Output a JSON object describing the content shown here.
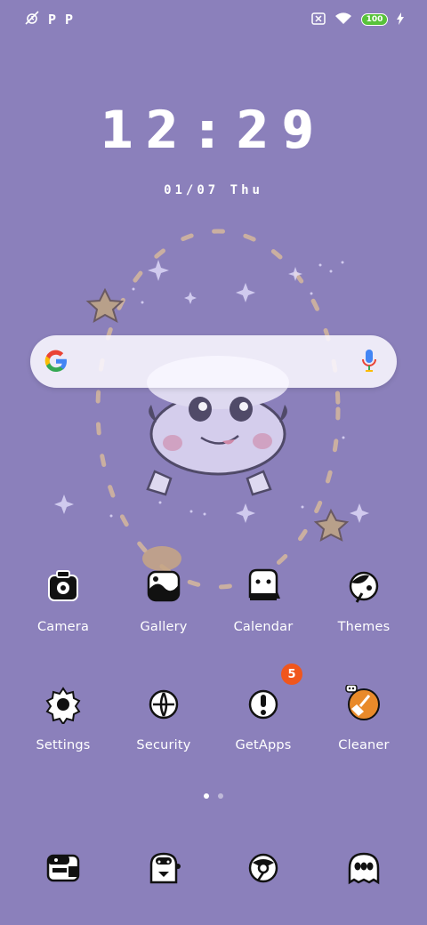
{
  "status_bar": {
    "notification_glyphs": [
      "P",
      "P"
    ],
    "battery_level": "100"
  },
  "lockscreen": {
    "time": "12:29",
    "date": "01/07  Thu"
  },
  "home_row_1": [
    {
      "label": "Camera",
      "icon": "camera-icon"
    },
    {
      "label": "Gallery",
      "icon": "gallery-icon"
    },
    {
      "label": "Calendar",
      "icon": "calendar-icon"
    },
    {
      "label": "Themes",
      "icon": "themes-icon"
    }
  ],
  "home_row_2": [
    {
      "label": "Settings",
      "icon": "settings-icon"
    },
    {
      "label": "Security",
      "icon": "security-icon"
    },
    {
      "label": "GetApps",
      "icon": "getapps-icon",
      "badge": "5"
    },
    {
      "label": "Cleaner",
      "icon": "cleaner-icon"
    }
  ],
  "dock": [
    {
      "icon": "messages-icon"
    },
    {
      "icon": "contacts-icon"
    },
    {
      "icon": "browser-icon"
    },
    {
      "icon": "phone-icon"
    }
  ],
  "page_indicator": {
    "pages": 2,
    "current": 1
  },
  "colors": {
    "background": "#8b80bb",
    "badge": "#f0561d",
    "cleaner_accent": "#e98a2a",
    "battery": "#58c23a"
  }
}
